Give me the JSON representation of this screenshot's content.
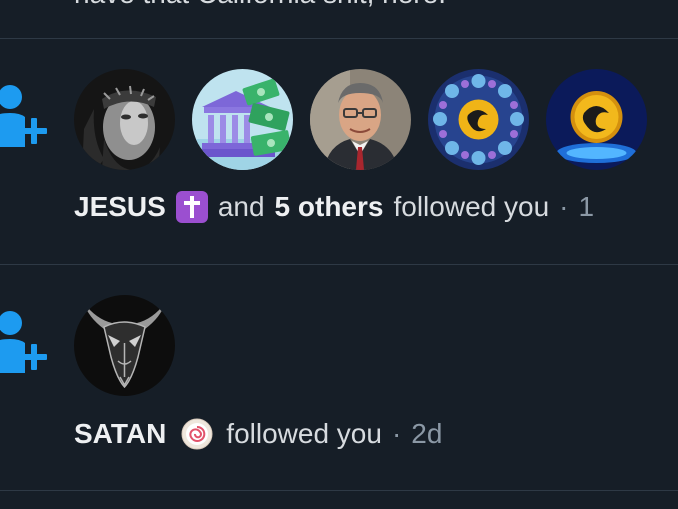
{
  "previous_post": {
    "fragment": "have that California shit, here."
  },
  "notifications": [
    {
      "type": "follow",
      "icon": "follow-person-plus-icon",
      "accent_color": "#1d9bf0",
      "avatars": [
        {
          "name": "jesus-avatar"
        },
        {
          "name": "money-bank-avatar"
        },
        {
          "name": "man-in-suit-avatar"
        },
        {
          "name": "crypto-coin-ring-avatar"
        },
        {
          "name": "crypto-coin-avatar"
        }
      ],
      "actor": "JESUS",
      "actor_badge": "cross-emoji-icon",
      "connector": "and",
      "others": "5 others",
      "action": "followed you",
      "separator": "·",
      "time": "1"
    },
    {
      "type": "follow",
      "icon": "follow-person-plus-icon",
      "accent_color": "#1d9bf0",
      "avatars": [
        {
          "name": "goat-skull-avatar"
        }
      ],
      "actor": "SATAN",
      "actor_badge": "spiral-emoji-icon",
      "action": "followed you",
      "separator": "·",
      "time": "2d"
    }
  ]
}
